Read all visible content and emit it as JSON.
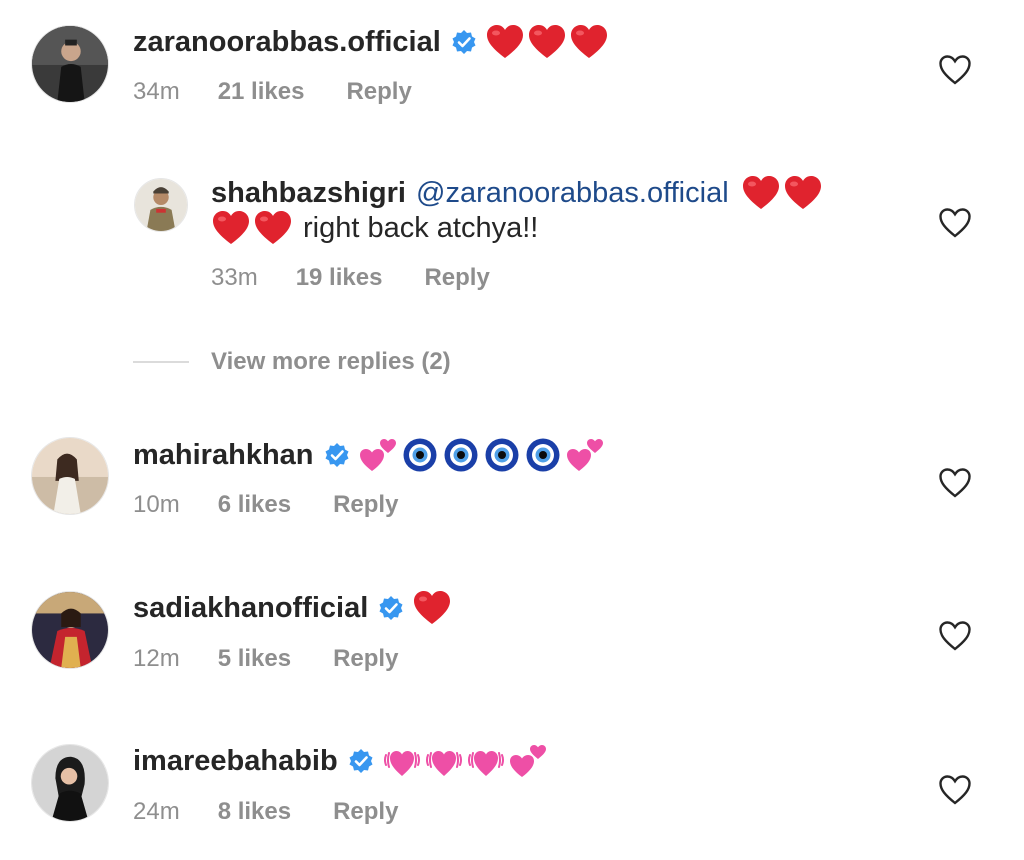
{
  "comments": [
    {
      "username": "zaranoorabbas.official",
      "verified": true,
      "emojis": [
        "red-heart",
        "red-heart",
        "red-heart"
      ],
      "time": "34m",
      "likes": "21 likes",
      "reply": "Reply"
    },
    {
      "username": "shahbazshigri",
      "verified": false,
      "mention": "@zaranoorabbas.official",
      "text": "right back atchya!!",
      "emojis_line1": [
        "red-heart",
        "red-heart"
      ],
      "emojis_line2": [
        "red-heart",
        "red-heart"
      ],
      "time": "33m",
      "likes": "19 likes",
      "reply": "Reply"
    },
    {
      "username": "mahirahkhan",
      "verified": true,
      "emojis": [
        "two-hearts",
        "nazar-amulet",
        "nazar-amulet",
        "nazar-amulet",
        "nazar-amulet",
        "two-hearts"
      ],
      "time": "10m",
      "likes": "6 likes",
      "reply": "Reply"
    },
    {
      "username": "sadiakhanofficial",
      "verified": true,
      "emojis": [
        "red-heart"
      ],
      "time": "12m",
      "likes": "5 likes",
      "reply": "Reply"
    },
    {
      "username": "imareebahabib",
      "verified": true,
      "emojis": [
        "vibrating-heart",
        "vibrating-heart",
        "vibrating-heart",
        "two-hearts"
      ],
      "time": "24m",
      "likes": "8 likes",
      "reply": "Reply"
    }
  ],
  "view_more": "View more replies (2)",
  "colors": {
    "verified_blue": "#3897f0",
    "red_heart": "#e0232e",
    "pink_heart": "#ee4fa6",
    "nazar_blue": "#1a3fa8",
    "meta_gray": "#8e8e8e",
    "mention_blue": "#1e4a8a"
  }
}
